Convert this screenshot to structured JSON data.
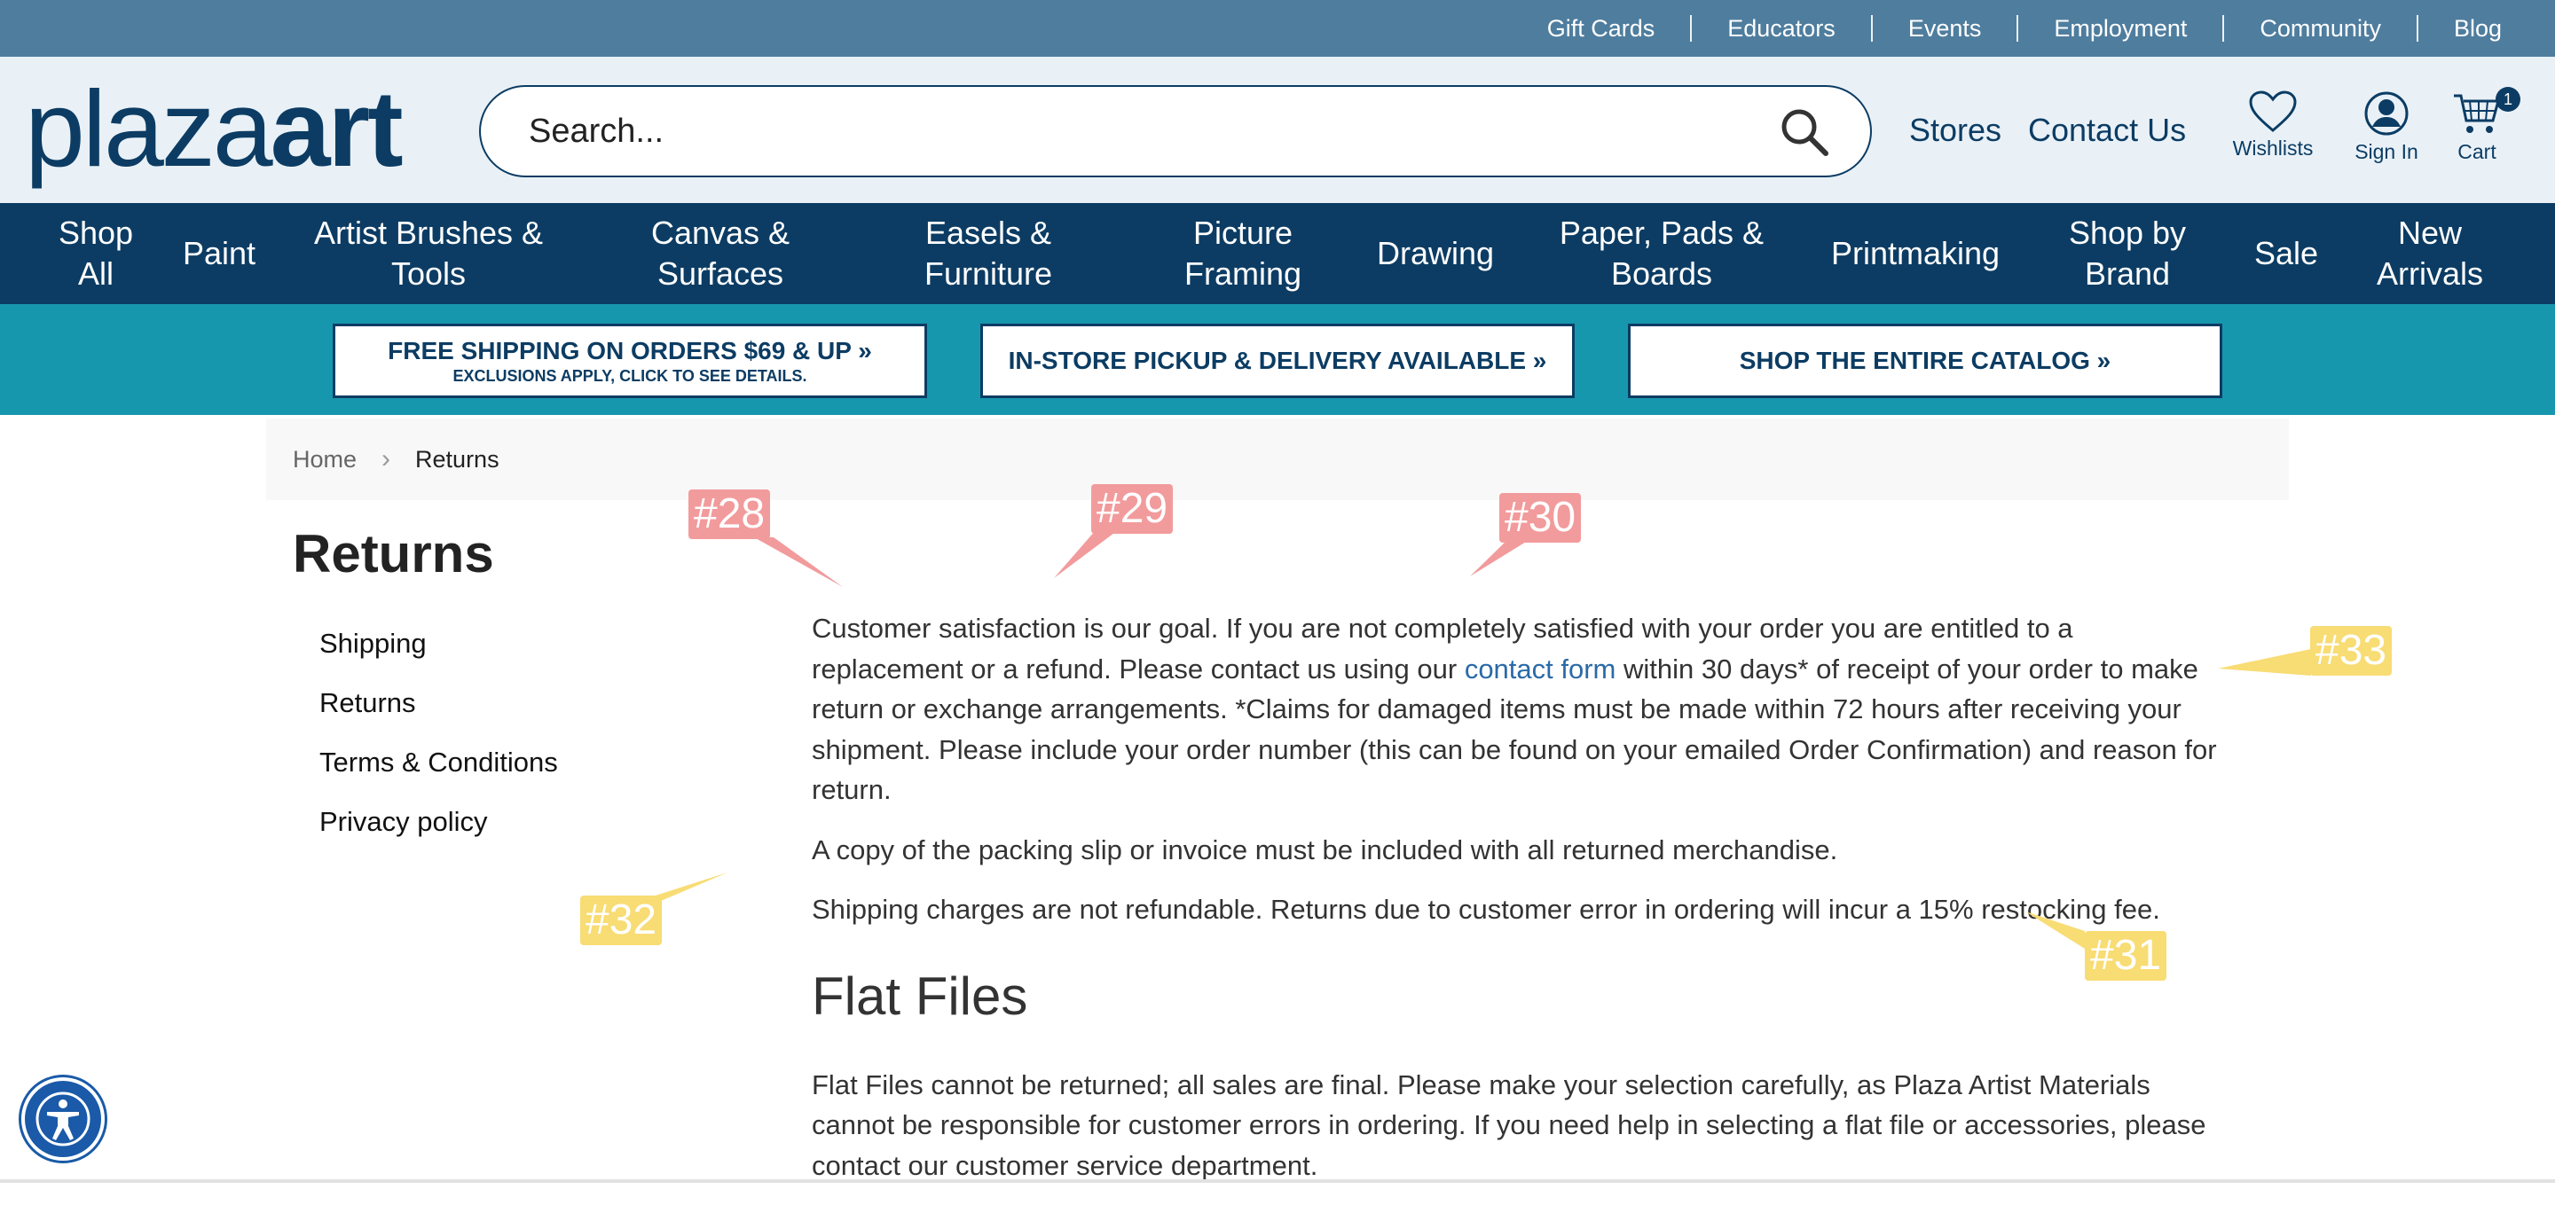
{
  "utility_links": [
    "Gift Cards",
    "Educators",
    "Events",
    "Employment",
    "Community",
    "Blog"
  ],
  "logo": {
    "part1": "plaza",
    "part2": "art"
  },
  "search": {
    "placeholder": "Search..."
  },
  "header_links": {
    "stores": "Stores",
    "contact": "Contact Us"
  },
  "header_icons": {
    "wishlists": "Wishlists",
    "signin": "Sign In",
    "cart": "Cart",
    "cart_count": "1"
  },
  "main_nav": [
    {
      "line1": "Shop",
      "line2": "All"
    },
    {
      "line1": "Paint",
      "line2": ""
    },
    {
      "line1": "Artist Brushes &",
      "line2": "Tools"
    },
    {
      "line1": "Canvas &",
      "line2": "Surfaces"
    },
    {
      "line1": "Easels &",
      "line2": "Furniture"
    },
    {
      "line1": "Picture",
      "line2": "Framing"
    },
    {
      "line1": "Drawing",
      "line2": ""
    },
    {
      "line1": "Paper, Pads &",
      "line2": "Boards"
    },
    {
      "line1": "Printmaking",
      "line2": ""
    },
    {
      "line1": "Shop by",
      "line2": "Brand"
    },
    {
      "line1": "Sale",
      "line2": ""
    },
    {
      "line1": "New",
      "line2": "Arrivals"
    }
  ],
  "promos": [
    {
      "line1": "FREE SHIPPING ON ORDERS $69 & UP »",
      "line2": "EXCLUSIONS APPLY, CLICK TO SEE DETAILS."
    },
    {
      "line1": "IN-STORE PICKUP & DELIVERY AVAILABLE »",
      "line2": ""
    },
    {
      "line1": "SHOP THE ENTIRE CATALOG »",
      "line2": ""
    }
  ],
  "breadcrumb": {
    "home": "Home",
    "separator": "›",
    "current": "Returns"
  },
  "page_title": "Returns",
  "sidebar": [
    "Shipping",
    "Returns",
    "Terms & Conditions",
    "Privacy policy"
  ],
  "content": {
    "p1_before": "Customer satisfaction is our goal. If you are not completely satisfied with your order you are entitled to a replacement or a refund. Please contact us using our ",
    "p1_link": "contact form",
    "p1_after": " within 30 days* of receipt of your order to make return or exchange arrangements. *Claims for damaged items must be made within 72 hours after receiving your shipment. Please include your order number (this can be found on your emailed Order Confirmation) and reason for return.",
    "p2": "A copy of the packing slip or invoice must be included with all returned merchandise.",
    "p3": "Shipping charges are not refundable. Returns due to customer error in ordering will incur a 15% restocking fee.",
    "h2": "Flat Files",
    "p4": "Flat Files cannot be returned; all sales are final. Please make your selection carefully, as Plaza Artist Materials cannot be responsible for customer errors in ordering. If you need help in selecting a flat file or accessories, please contact our customer service department."
  },
  "annotations": [
    "#28",
    "#29",
    "#30",
    "#31",
    "#32",
    "#33"
  ],
  "colors": {
    "navy": "#0c3c63",
    "utility": "#4f7d9e",
    "teal": "#1797ad",
    "tag_red": "#f29b9c",
    "tag_yellow": "#f8dc74",
    "link": "#2a6aa8"
  }
}
